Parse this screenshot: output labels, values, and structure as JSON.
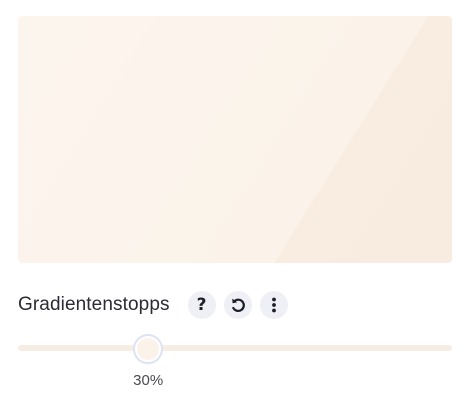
{
  "preview": {
    "gradient_start_color": "#fcf5ee",
    "gradient_end_color": "#f8ebdf"
  },
  "gradient_stops": {
    "label": "Gradientenstopps",
    "help_icon": "question-mark-icon",
    "reset_icon": "undo-icon",
    "more_icon": "more-vertical-icon",
    "help_glyph": "?",
    "stop_position_percent": 30,
    "stop_value_label": "30%",
    "stop_color": "#fbf3ea"
  }
}
